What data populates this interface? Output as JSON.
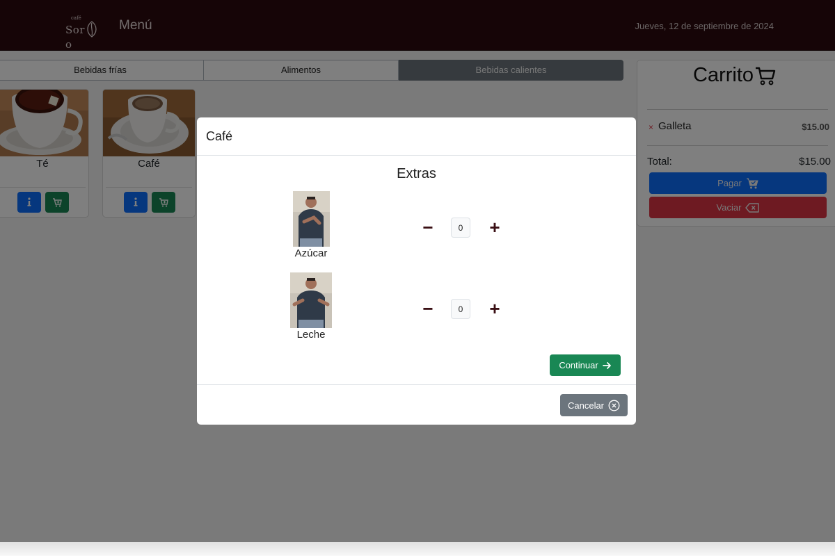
{
  "header": {
    "logo_small": "café",
    "logo_main": "Sor",
    "logo_suffix": "o",
    "title": "Menú",
    "date": "Jueves, 12 de septiembre de 2024"
  },
  "tabs": [
    {
      "label": "Bebidas frías",
      "active": false
    },
    {
      "label": "Alimentos",
      "active": false
    },
    {
      "label": "Bebidas calientes",
      "active": true
    }
  ],
  "products": [
    {
      "name": "Té",
      "image": "tea-cup"
    },
    {
      "name": "Café",
      "image": "coffee-cup"
    }
  ],
  "cart": {
    "title": "Carrito",
    "items": [
      {
        "name": "Galleta",
        "price": "$15.00",
        "remove_icon": "×"
      }
    ],
    "total_label": "Total:",
    "total_value": "$15.00",
    "pay_label": "Pagar",
    "empty_label": "Vaciar"
  },
  "modal": {
    "title": "Café",
    "extras_title": "Extras",
    "extras": [
      {
        "name": "Azúcar",
        "quantity": "0",
        "minus": "−",
        "plus": "+"
      },
      {
        "name": "Leche",
        "quantity": "0",
        "minus": "−",
        "plus": "+"
      }
    ],
    "continue_label": "Continuar",
    "cancel_label": "Cancelar"
  },
  "colors": {
    "header_bg": "#2d0a0e",
    "primary": "#0d6efd",
    "success": "#198754",
    "danger": "#dc3545",
    "secondary": "#6c757d",
    "stepper": "#3a0f14"
  }
}
